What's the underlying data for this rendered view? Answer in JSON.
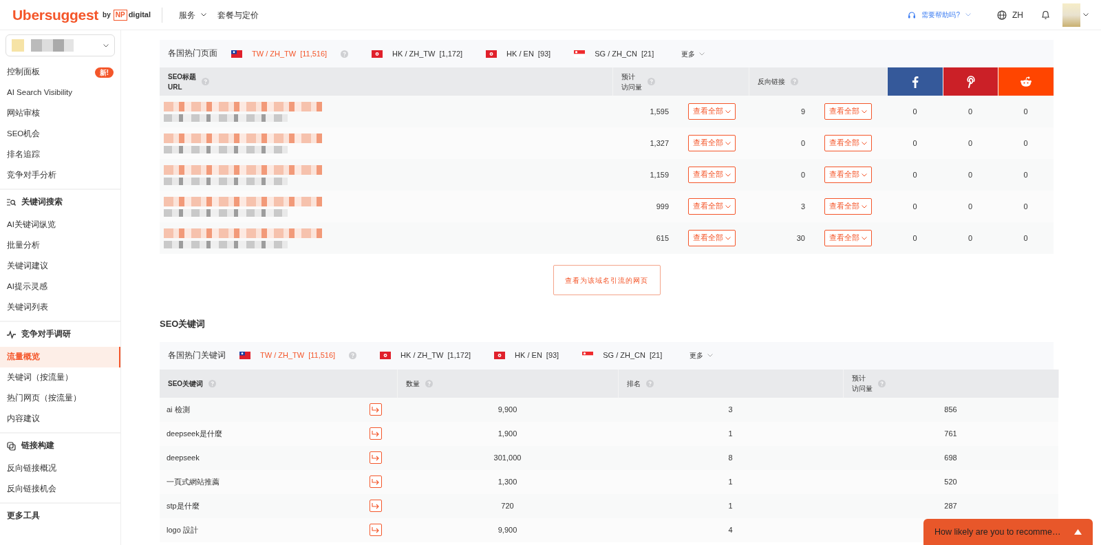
{
  "header": {
    "logo": {
      "name": "Ubersuggest",
      "by": "by",
      "np": "NP",
      "digital": "digital"
    },
    "nav": [
      {
        "label": "服务",
        "dropdown": true
      },
      {
        "label": "套餐与定价",
        "dropdown": false
      }
    ],
    "help": "需要帮助吗?",
    "language": "ZH"
  },
  "sidebar": {
    "sections": [
      {
        "items": [
          {
            "label": "控制面板",
            "badge": "新!",
            "selected": false
          },
          {
            "label": "AI Search Visibility",
            "selected": false
          },
          {
            "label": "网站审核",
            "selected": false
          },
          {
            "label": "SEO机会",
            "selected": false
          },
          {
            "label": "排名追踪",
            "selected": false
          },
          {
            "label": "竞争对手分析",
            "selected": false
          }
        ]
      },
      {
        "title": "关键词搜索",
        "items": [
          {
            "label": "AI关键词纵览",
            "selected": false
          },
          {
            "label": "批量分析",
            "selected": false
          },
          {
            "label": "关键词建议",
            "selected": false
          },
          {
            "label": "AI提示灵感",
            "selected": false
          },
          {
            "label": "关键词列表",
            "selected": false
          }
        ]
      },
      {
        "title": "竞争对手调研",
        "items": [
          {
            "label": "流量概览",
            "selected": true
          },
          {
            "label": "关键词（按流量）",
            "selected": false
          },
          {
            "label": "热门网页（按流量）",
            "selected": false
          },
          {
            "label": "内容建议",
            "selected": false
          }
        ]
      },
      {
        "title": "链接构建",
        "items": [
          {
            "label": "反向链接概况",
            "selected": false
          },
          {
            "label": "反向链接机会",
            "selected": false
          }
        ]
      },
      {
        "title": "更多工具"
      }
    ]
  },
  "top_pages": {
    "label": "各国热门页面",
    "countries": [
      {
        "kind": "tw",
        "label": "TW / ZH_TW",
        "count": "[11,516]",
        "selected": true
      },
      {
        "kind": "hk",
        "label": "HK / ZH_TW",
        "count": "[1,172]",
        "selected": false
      },
      {
        "kind": "hk",
        "label": "HK / EN",
        "count": "[93]",
        "selected": false
      },
      {
        "kind": "sg",
        "label": "SG / ZH_CN",
        "count": "[21]",
        "selected": false
      }
    ],
    "more": "更多",
    "columns": [
      {
        "kind": "text",
        "label": "SEO标题",
        "sublabel": "URL"
      },
      {
        "kind": "text",
        "label": "预计",
        "sublabel": "访问量"
      },
      {
        "kind": "text",
        "label": "反向链接"
      },
      {
        "kind": "facebook"
      },
      {
        "kind": "pinterest"
      },
      {
        "kind": "reddit"
      }
    ],
    "rows": [
      {
        "traffic": "1,595",
        "traffic_button": "查看全部",
        "backlinks": "9",
        "backlinks_button": "查看全部",
        "facebook": "0",
        "pinterest": "0",
        "reddit": "0"
      },
      {
        "traffic": "1,327",
        "traffic_button": "查看全部",
        "backlinks": "0",
        "backlinks_button": "查看全部",
        "facebook": "0",
        "pinterest": "0",
        "reddit": "0"
      },
      {
        "traffic": "1,159",
        "traffic_button": "查看全部",
        "backlinks": "0",
        "backlinks_button": "查看全部",
        "facebook": "0",
        "pinterest": "0",
        "reddit": "0"
      },
      {
        "traffic": "999",
        "traffic_button": "查看全部",
        "backlinks": "3",
        "backlinks_button": "查看全部",
        "facebook": "0",
        "pinterest": "0",
        "reddit": "0"
      },
      {
        "traffic": "615",
        "traffic_button": "查看全部",
        "backlinks": "30",
        "backlinks_button": "查看全部",
        "facebook": "0",
        "pinterest": "0",
        "reddit": "0"
      }
    ],
    "view_button": "查看为该域名引流的网页"
  },
  "keywords": {
    "title": "SEO关键词",
    "label": "各国热门关键词",
    "countries": [
      {
        "kind": "tw",
        "label": "TW / ZH_TW",
        "count": "[11,516]",
        "selected": true
      },
      {
        "kind": "hk",
        "label": "HK / ZH_TW",
        "count": "[1,172]",
        "selected": false
      },
      {
        "kind": "hk",
        "label": "HK / EN",
        "count": "[93]",
        "selected": false
      },
      {
        "kind": "sg",
        "label": "SG / ZH_CN",
        "count": "[21]",
        "selected": false
      }
    ],
    "more": "更多",
    "columns": [
      {
        "label": "SEO关键词"
      },
      {
        "label": "数量"
      },
      {
        "label": "排名"
      },
      {
        "label": "预计",
        "sublabel": "访问量"
      }
    ],
    "rows": [
      {
        "keyword": "ai 檢測",
        "volume": "9,900",
        "rank": "3",
        "traffic": "856"
      },
      {
        "keyword": "deepseek是什麼",
        "volume": "1,900",
        "rank": "1",
        "traffic": "761"
      },
      {
        "keyword": "deepseek",
        "volume": "301,000",
        "rank": "8",
        "traffic": "698"
      },
      {
        "keyword": "一頁式網站推薦",
        "volume": "1,300",
        "rank": "1",
        "traffic": "520"
      },
      {
        "keyword": "stp是什麼",
        "volume": "720",
        "rank": "1",
        "traffic": "287"
      },
      {
        "keyword": "logo 設計",
        "volume": "9,900",
        "rank": "4"
      }
    ]
  },
  "survey": {
    "text": "How likely are you to recomme…"
  }
}
